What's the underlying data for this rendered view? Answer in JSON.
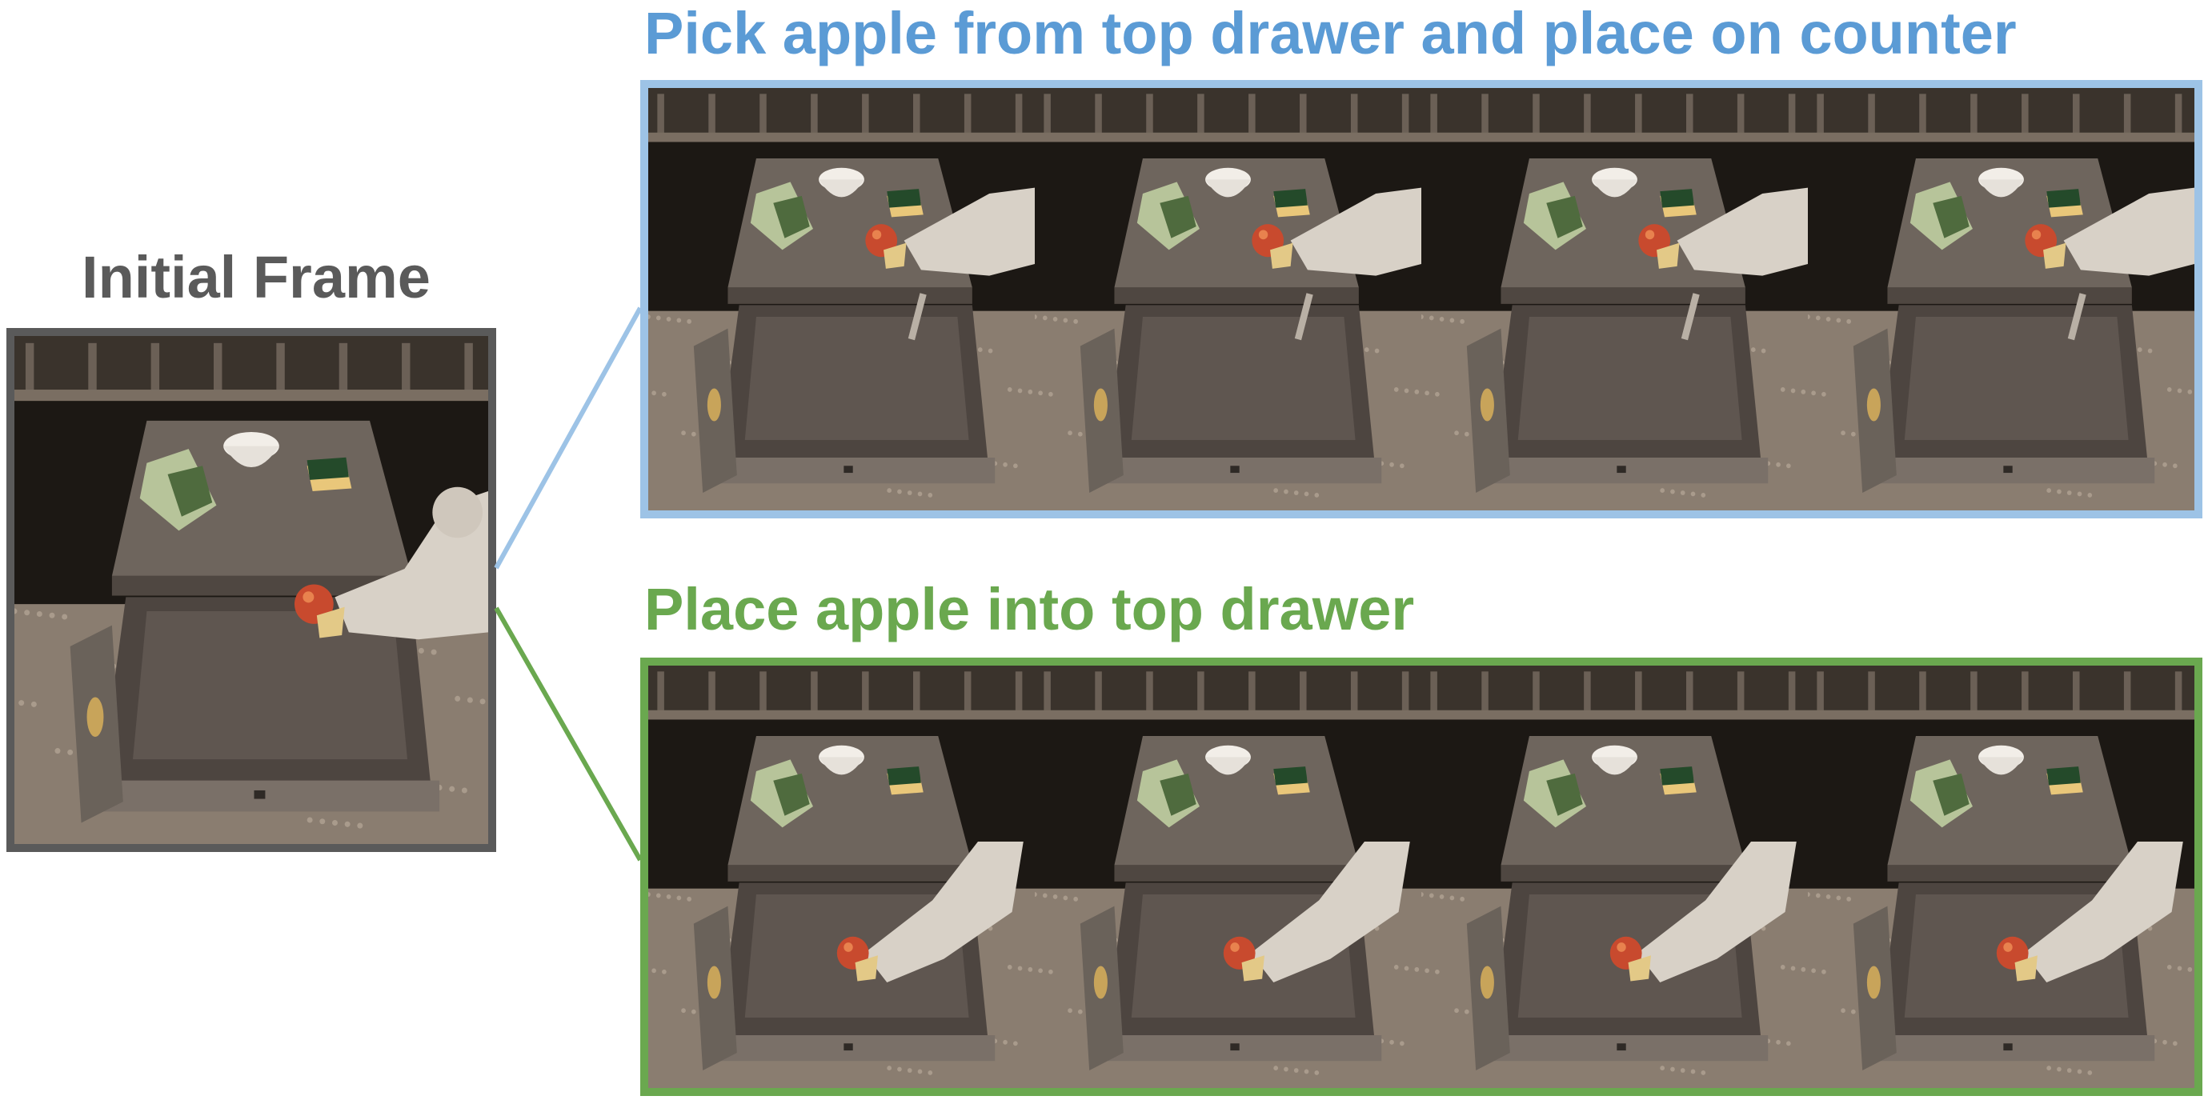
{
  "initial": {
    "title": "Initial Frame",
    "border_color": "#5a5a5a",
    "frame_state": {
      "apple": "gripper",
      "arm": "right"
    }
  },
  "rollouts": [
    {
      "title": "Pick apple from top drawer and place on counter",
      "color": "#9dc3e6",
      "title_color": "#5b9bd5",
      "frames": [
        {
          "apple": "counter",
          "arm": "counter"
        },
        {
          "apple": "counter",
          "arm": "counter"
        },
        {
          "apple": "counter",
          "arm": "counter"
        },
        {
          "apple": "counter",
          "arm": "counter"
        }
      ]
    },
    {
      "title": "Place apple into top drawer",
      "color": "#6aa84f",
      "title_color": "#6aa84f",
      "frames": [
        {
          "apple": "drawer",
          "arm": "drawer"
        },
        {
          "apple": "drawer",
          "arm": "drawer"
        },
        {
          "apple": "drawer",
          "arm": "drawer"
        },
        {
          "apple": "drawer",
          "arm": "drawer"
        }
      ]
    }
  ]
}
